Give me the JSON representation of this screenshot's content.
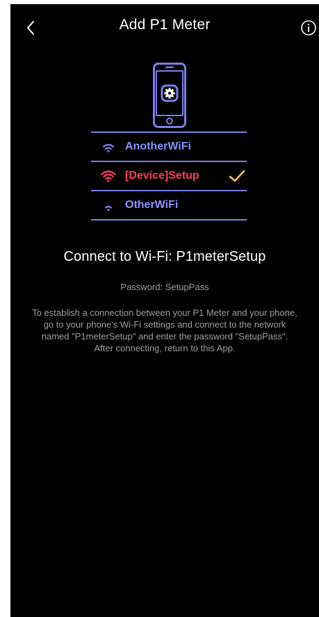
{
  "header": {
    "title": "Add P1 Meter",
    "back_icon": "chevron-left-icon",
    "info_icon": "info-circle-icon"
  },
  "illustration": {
    "phone_icon": "phone-settings-icon",
    "networks": [
      {
        "name": "AnotherWiFi",
        "icon": "wifi-icon",
        "state": "available"
      },
      {
        "name": "[Device]Setup",
        "icon": "wifi-icon",
        "state": "selected"
      },
      {
        "name": "OtherWiFi",
        "icon": "wifi-icon",
        "state": "available"
      }
    ],
    "colors": {
      "line": "#7b7fe6",
      "network_label": "#8b90ff",
      "selected_label": "#ff3d62",
      "checkmark": "#f2c069"
    }
  },
  "main": {
    "heading": "Connect to Wi-Fi: P1meterSetup",
    "password_line": "Password: SetupPass",
    "instructions": "To establish a connection between your P1 Meter and your phone, go to your phone's Wi-Fi settings and connect to the network named \"P1meterSetup\" and enter the password \"SetupPass\". After connecting, return to this App."
  }
}
